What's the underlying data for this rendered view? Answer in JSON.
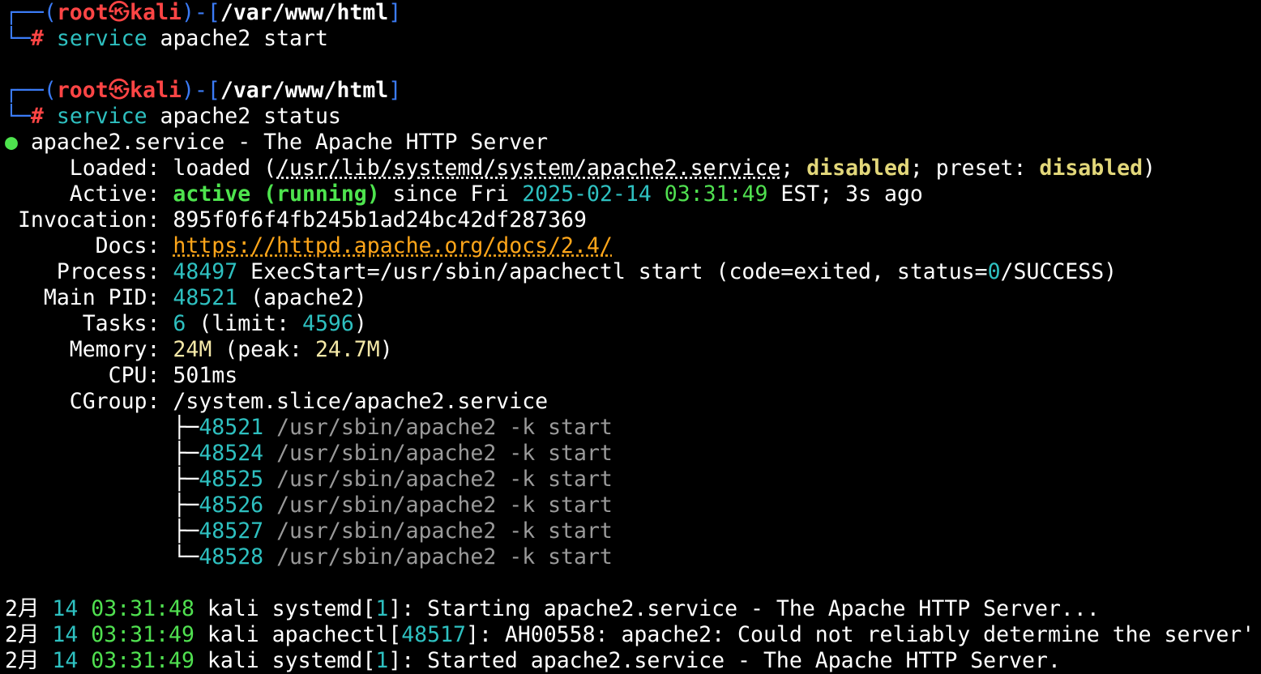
{
  "colors": {
    "background": "#000000",
    "prompt_frame": "#3b7bf6",
    "prompt_user": "#ff4545",
    "command": "#2ec0c0",
    "active_green": "#4ee44e",
    "disabled_yellow": "#e2d77a",
    "link_orange": "#ffa61a",
    "dim_gray": "#9a9a9a"
  },
  "prompt1": {
    "open": "┌──(",
    "user": "root",
    "sep_icon": "㉿",
    "host": "kali",
    "mid": ")-[",
    "path": "/var/www/html",
    "close": "]",
    "arrow": "└─",
    "hash": "#",
    "cmd": "service",
    "args": "apache2 start"
  },
  "prompt2": {
    "open": "┌──(",
    "user": "root",
    "sep_icon": "㉿",
    "host": "kali",
    "mid": ")-[",
    "path": "/var/www/html",
    "close": "]",
    "arrow": "└─",
    "hash": "#",
    "cmd": "service",
    "args": "apache2 status"
  },
  "status": {
    "bullet": "●",
    "title": "apache2.service - The Apache HTTP Server",
    "loaded_label": "     Loaded: ",
    "loaded_pre": "loaded (",
    "loaded_path": "/usr/lib/systemd/system/apache2.service",
    "loaded_sep1": "; ",
    "loaded_state": "disabled",
    "loaded_sep2": "; preset: ",
    "loaded_preset": "disabled",
    "loaded_post": ")",
    "active_label": "     Active: ",
    "active_state": "active (running)",
    "active_since": " since Fri ",
    "date_y": "2025",
    "date_d1": "-",
    "date_m": "02",
    "date_d2": "-",
    "date_day": "14",
    "time": "03:31:49",
    "active_tail": " EST; 3s ago",
    "invocation_label": " Invocation: ",
    "invocation_value": "895f0f6f4fb245b1ad24bc42df287369",
    "docs_label": "       Docs: ",
    "docs_url": "https://httpd.apache.org/docs/2.4/",
    "process_label": "    Process: ",
    "process_pid": "48497",
    "process_text": " ExecStart=/usr/sbin/apachectl start (code=exited, status=",
    "process_status": "0",
    "process_tail": "/SUCCESS)",
    "mainpid_label": "   Main PID: ",
    "mainpid_value": "48521",
    "mainpid_tail": " (apache2)",
    "tasks_label": "      Tasks: ",
    "tasks_value": "6",
    "tasks_mid": " (limit: ",
    "tasks_limit": "4596",
    "tasks_tail": ")",
    "memory_label": "     Memory: ",
    "memory_value": "24M",
    "memory_mid": " (peak: ",
    "memory_peak": "24.7M",
    "memory_tail": ")",
    "cpu_label": "        CPU: ",
    "cpu_value": "501ms",
    "cgroup_label": "     CGroup: ",
    "cgroup_value": "/system.slice/apache2.service"
  },
  "cgroup_tree": [
    {
      "branch": "             ├─",
      "pid": "48521",
      "cmd": " /usr/sbin/apache2 -k start"
    },
    {
      "branch": "             ├─",
      "pid": "48524",
      "cmd": " /usr/sbin/apache2 -k start"
    },
    {
      "branch": "             ├─",
      "pid": "48525",
      "cmd": " /usr/sbin/apache2 -k start"
    },
    {
      "branch": "             ├─",
      "pid": "48526",
      "cmd": " /usr/sbin/apache2 -k start"
    },
    {
      "branch": "             ├─",
      "pid": "48527",
      "cmd": " /usr/sbin/apache2 -k start"
    },
    {
      "branch": "             └─",
      "pid": "48528",
      "cmd": " /usr/sbin/apache2 -k start"
    }
  ],
  "journal": [
    {
      "month": "2月",
      "day": " 14",
      "time": " 03:31:48",
      "host": " kali systemd[",
      "pid": "1",
      "msg": "]: Starting apache2.service - The Apache HTTP Server..."
    },
    {
      "month": "2月",
      "day": " 14",
      "time": " 03:31:49",
      "host": " kali apachectl[",
      "pid": "48517",
      "msg": "]: AH00558: apache2: Could not reliably determine the server'"
    },
    {
      "month": "2月",
      "day": " 14",
      "time": " 03:31:49",
      "host": " kali systemd[",
      "pid": "1",
      "msg": "]: Started apache2.service - The Apache HTTP Server."
    }
  ]
}
